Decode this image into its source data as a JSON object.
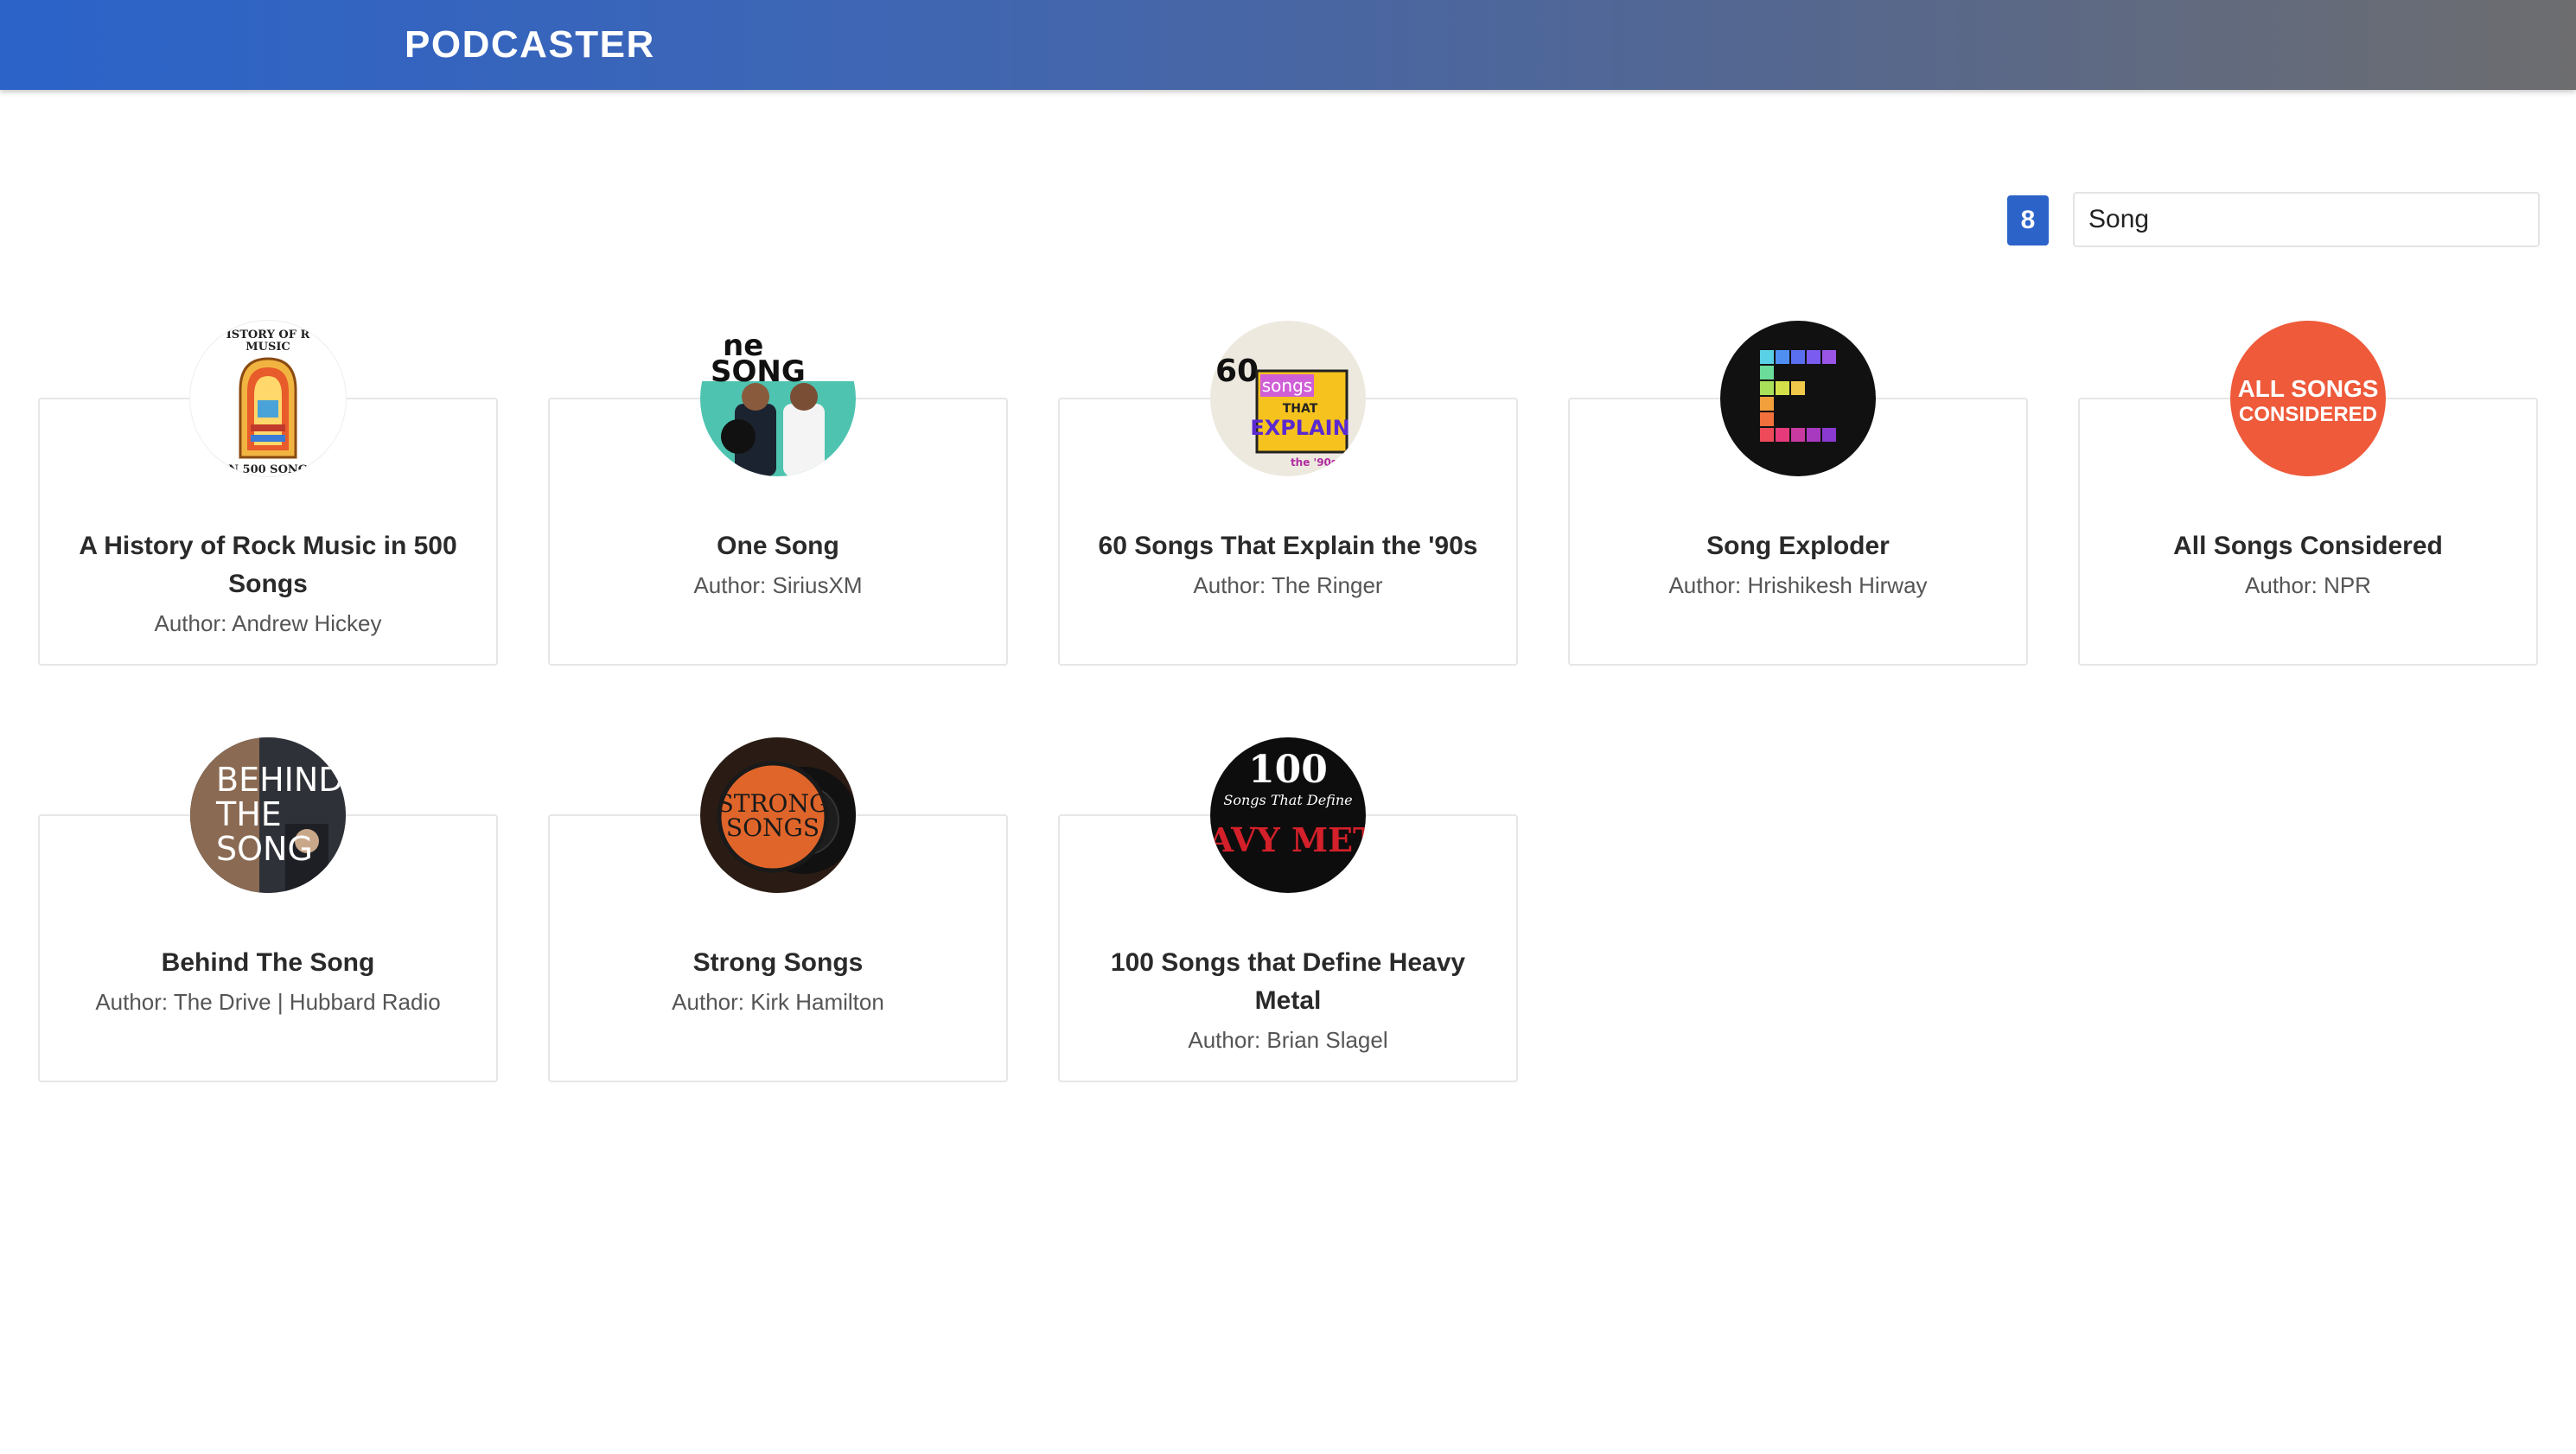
{
  "header": {
    "brand": "PODCASTER"
  },
  "search": {
    "count": "8",
    "value": "Song"
  },
  "podcasts": [
    {
      "title": "A History of Rock Music in 500 Songs",
      "author": "Author: Andrew Hickey",
      "cover_text": [
        "ISTORY OF R",
        "MUSIC",
        "N 500 SONG"
      ]
    },
    {
      "title": "One Song",
      "author": "Author: SiriusXM",
      "cover_text": [
        "ne",
        "SONG"
      ]
    },
    {
      "title": "60 Songs That Explain the '90s",
      "author": "Author: The Ringer",
      "cover_text": [
        "60",
        "songs",
        "THAT",
        "EXPLAIN",
        "the '90s"
      ]
    },
    {
      "title": "Song Exploder",
      "author": "Author: Hrishikesh Hirway",
      "cover_text": []
    },
    {
      "title": "All Songs Considered",
      "author": "Author: NPR",
      "cover_text": [
        "ALL SONGS",
        "CONSIDERED"
      ]
    },
    {
      "title": "Behind The Song",
      "author": "Author: The Drive | Hubbard Radio",
      "cover_text": [
        "BEHIND",
        "THE",
        "SONG"
      ]
    },
    {
      "title": "Strong Songs",
      "author": "Author: Kirk Hamilton",
      "cover_text": [
        "STRONG",
        "SONGS"
      ]
    },
    {
      "title": "100 Songs that Define Heavy Metal",
      "author": "Author: Brian Slagel",
      "cover_text": [
        "100",
        "Songs That Define",
        "HEAVY METAL"
      ]
    }
  ],
  "colors": {
    "accent": "#2b63c9",
    "header_gradient_end": "#6d6d6f",
    "all_songs_orange": "#ee5a3a",
    "strong_songs_orange": "#e0652a",
    "heavy_metal_red": "#d3202a"
  }
}
